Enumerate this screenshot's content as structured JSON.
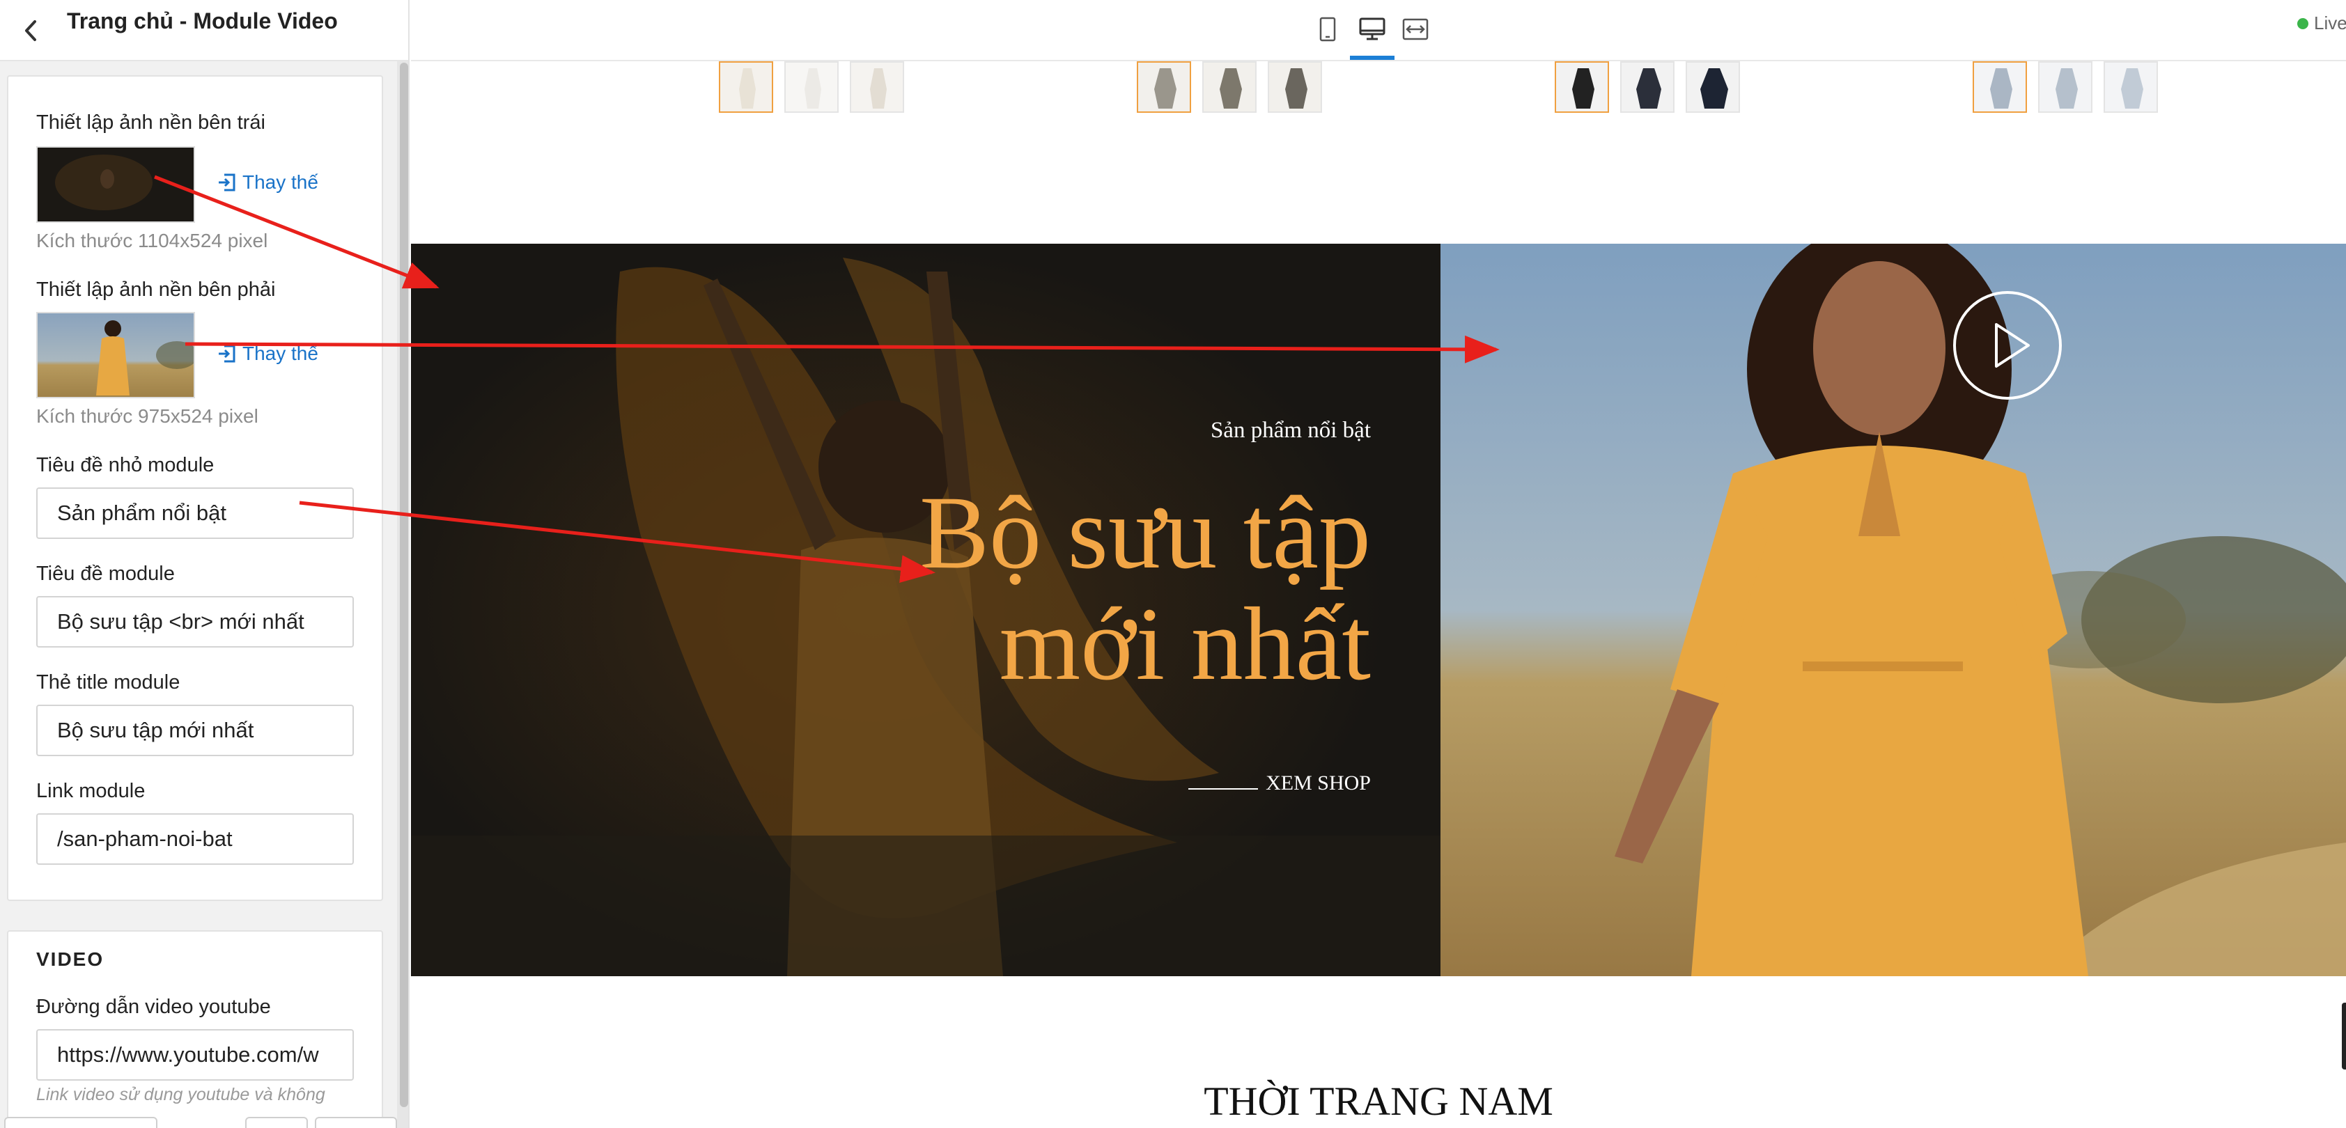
{
  "header": {
    "title": "Trang chủ - Module Video",
    "live_label": "Live"
  },
  "sidebar": {
    "left_bg": {
      "label": "Thiết lập ảnh nền bên trái",
      "replace_label": "Thay thế",
      "size_hint": "Kích thước 1104x524 pixel"
    },
    "right_bg": {
      "label": "Thiết lập ảnh nền bên phải",
      "replace_label": "Thay thế",
      "size_hint": "Kích thước 975x524 pixel"
    },
    "subtitle_field": {
      "label": "Tiêu đề nhỏ module",
      "value": "Sản phẩm nổi bật"
    },
    "title_field": {
      "label": "Tiêu đề module",
      "value": "Bộ sưu tập <br> mới nhất"
    },
    "title_tag_field": {
      "label": "Thẻ title module",
      "value": "Bộ sưu tập mới nhất"
    },
    "link_field": {
      "label": "Link module",
      "value": "/san-pham-noi-bat"
    },
    "video_section": {
      "title": "VIDEO",
      "url_label": "Đường dẫn video youtube",
      "url_value": "https://www.youtube.com/w",
      "hint": "Link video sử dụng youtube và không"
    }
  },
  "toolbar": {
    "devices": [
      "mobile",
      "desktop",
      "fullwidth"
    ],
    "active_device": "desktop"
  },
  "preview": {
    "subtitle": "Sản phẩm nổi bật",
    "title_line1": "Bộ sưu tập",
    "title_line2": "mới nhất",
    "shop_link": "XEM SHOP",
    "section_heading": "THỜI TRANG NAM"
  },
  "colors": {
    "accent": "#f2a646",
    "link": "#1a73c8",
    "active_tab": "#1c7fd6",
    "annotation_arrow": "#e8201b",
    "live_dot": "#3bb54a"
  }
}
